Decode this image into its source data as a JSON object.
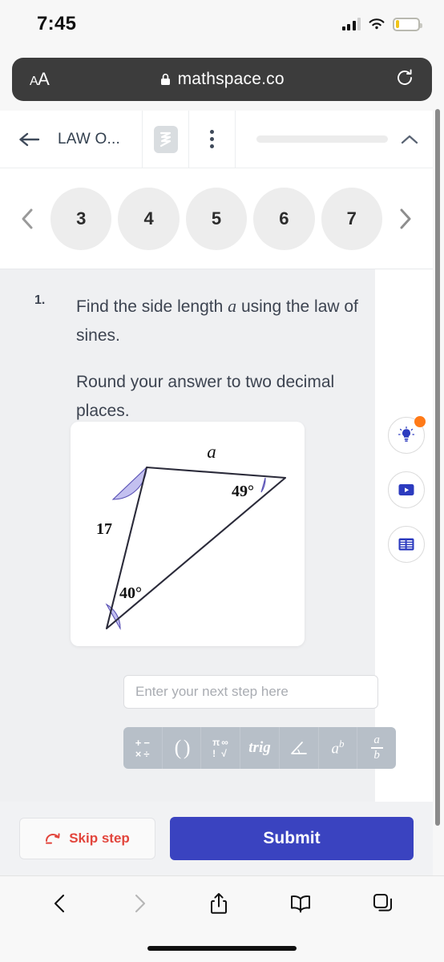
{
  "status_bar": {
    "time": "7:45",
    "signal_icon": "cellular-bars-icon",
    "wifi_icon": "wifi-icon",
    "battery_icon": "battery-low-icon"
  },
  "browser": {
    "text_size_label": "A",
    "text_size_label_small": "A",
    "lock_icon": "lock-icon",
    "url": "mathspace.co",
    "reload_icon": "reload-icon",
    "bottom_bar": {
      "back_icon": "chevron-left-icon",
      "forward_icon": "chevron-right-icon",
      "share_icon": "share-icon",
      "bookmarks_icon": "book-icon",
      "tabs_icon": "tabs-icon"
    }
  },
  "page_header": {
    "back_icon": "arrow-left-icon",
    "title": "LAW O...",
    "logo_icon": "mathspace-logo-icon",
    "menu_icon": "kebab-menu-icon",
    "collapse_icon": "chevron-up-icon"
  },
  "pagination": {
    "prev_icon": "chevron-left-icon",
    "next_icon": "chevron-right-icon",
    "pages": [
      "3",
      "4",
      "5",
      "6",
      "7"
    ]
  },
  "question": {
    "number": "1.",
    "line1_before": "Find the side length ",
    "line1_var": "a",
    "line1_after": " using the law of sines.",
    "line2": "Round your answer to two decimal places."
  },
  "diagram": {
    "side_label_a": "a",
    "side_label_17": "17",
    "angle_49": "49°",
    "angle_40": "40°",
    "angle_fill": "#c3c0f0",
    "stroke": "#2b2b3a"
  },
  "side_actions": [
    {
      "name": "hint-button",
      "icon": "lightbulb-icon",
      "has_badge": true
    },
    {
      "name": "video-button",
      "icon": "video-play-icon",
      "has_badge": false
    },
    {
      "name": "reference-button",
      "icon": "table-reference-icon",
      "has_badge": false
    }
  ],
  "answer": {
    "placeholder": "Enter your next step here",
    "value": ""
  },
  "math_toolbar": {
    "keys": [
      {
        "name": "operators-key",
        "label": "+ − × ÷"
      },
      {
        "name": "parentheses-key",
        "label": "( )"
      },
      {
        "name": "constants-roots-key",
        "label": "π ∞ ! √"
      },
      {
        "name": "trig-key",
        "label": "trig"
      },
      {
        "name": "angle-key",
        "label": "∠"
      },
      {
        "name": "exponent-key",
        "label": "a^b"
      },
      {
        "name": "fraction-key",
        "label": "a/b"
      }
    ]
  },
  "footer": {
    "skip_icon": "skip-arrow-icon",
    "skip_label": "Skip step",
    "submit_label": "Submit",
    "submit_color": "#3a43c0",
    "skip_color": "#e2453c"
  }
}
